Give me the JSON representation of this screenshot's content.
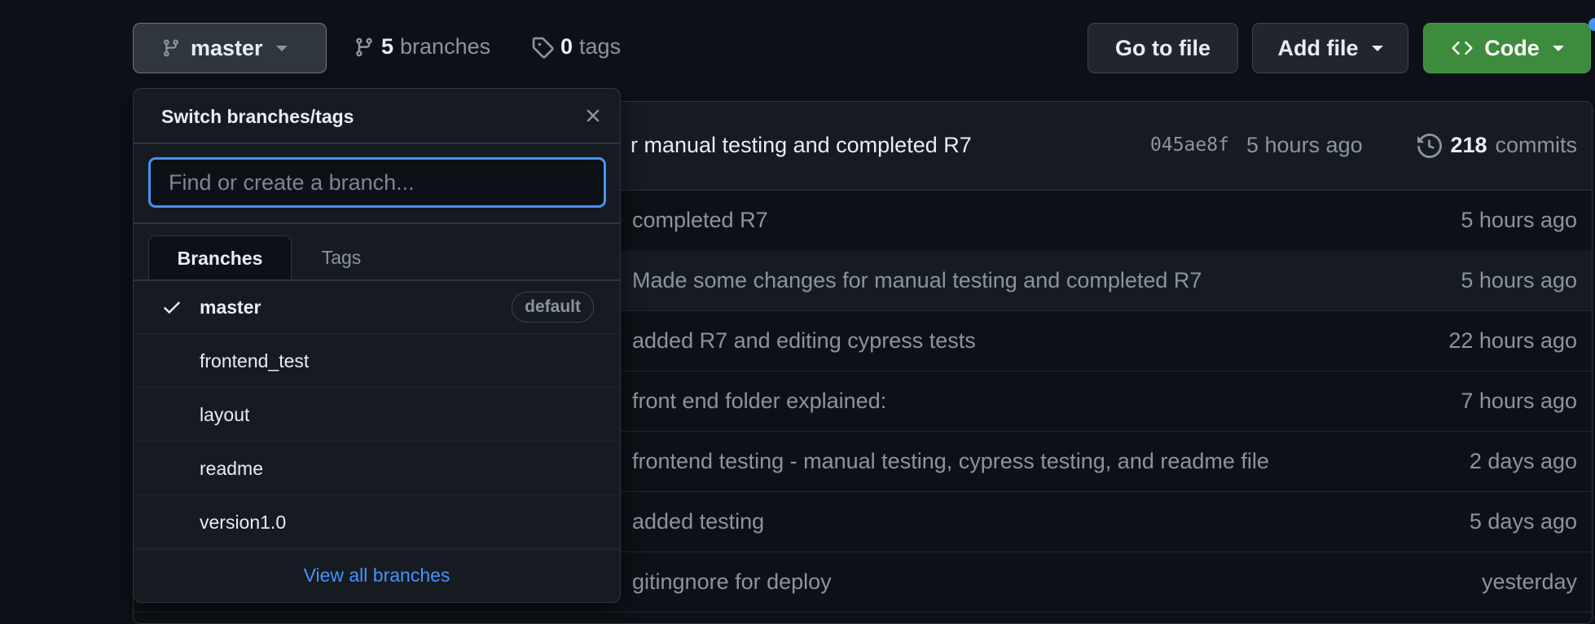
{
  "toolbar": {
    "branch_button_label": "master",
    "branches_count": "5",
    "branches_label": "branches",
    "tags_count": "0",
    "tags_label": "tags",
    "go_to_file_label": "Go to file",
    "add_file_label": "Add file",
    "code_label": "Code"
  },
  "latest_commit": {
    "message": "r manual testing and completed R7",
    "hash": "045ae8f",
    "time": "5 hours ago",
    "commits_count": "218",
    "commits_label": "commits"
  },
  "file_rows": [
    {
      "message": "completed R7",
      "age": "5 hours ago"
    },
    {
      "message": "Made some changes for manual testing and completed R7",
      "age": "5 hours ago"
    },
    {
      "message": "added R7 and editing cypress tests",
      "age": "22 hours ago"
    },
    {
      "message": "front end folder explained:",
      "age": "7 hours ago"
    },
    {
      "message": "frontend testing - manual testing, cypress testing, and readme file",
      "age": "2 days ago"
    },
    {
      "message": "added testing",
      "age": "5 days ago"
    },
    {
      "message": "gitingnore for deploy",
      "age": "yesterday"
    }
  ],
  "dropdown": {
    "title": "Switch branches/tags",
    "search_placeholder": "Find or create a branch...",
    "tabs": [
      {
        "label": "Branches"
      },
      {
        "label": "Tags"
      }
    ],
    "branches": [
      {
        "name": "master",
        "badge": "default"
      },
      {
        "name": "frontend_test"
      },
      {
        "name": "layout"
      },
      {
        "name": "readme"
      },
      {
        "name": "version1.0"
      }
    ],
    "view_all_label": "View all branches"
  },
  "colors": {
    "background": "#0d1117",
    "accent_blue": "#4493f8",
    "code_button_green": "#3d8b3d"
  },
  "icons": {
    "branch": "git-branch-icon",
    "tag": "tag-icon",
    "history": "history-icon",
    "code": "code-icon",
    "close": "close-icon",
    "check": "check-icon"
  }
}
